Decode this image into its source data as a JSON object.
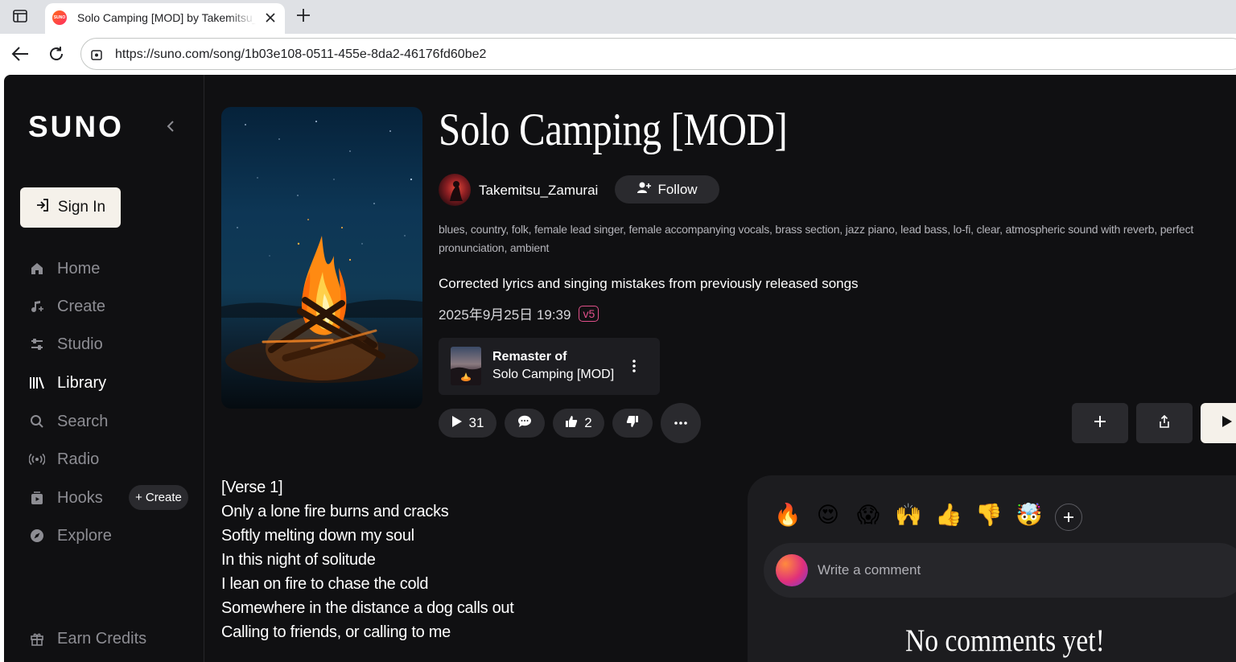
{
  "browser": {
    "tab_title": "Solo Camping [MOD] by Takemitsu_Zamurai",
    "tab_favicon_text": "SUNO",
    "url": "https://suno.com/song/1b03e108-0511-455e-8da2-46176fd60be2"
  },
  "sidebar": {
    "logo": "SUNO",
    "sign_in_label": "Sign In",
    "items": [
      {
        "label": "Home",
        "icon": "home-icon"
      },
      {
        "label": "Create",
        "icon": "music-note-icon"
      },
      {
        "label": "Studio",
        "icon": "sliders-icon"
      },
      {
        "label": "Library",
        "icon": "library-icon"
      },
      {
        "label": "Search",
        "icon": "search-icon"
      },
      {
        "label": "Radio",
        "icon": "radio-icon"
      },
      {
        "label": "Hooks",
        "icon": "hooks-icon"
      },
      {
        "label": "Explore",
        "icon": "compass-icon"
      }
    ],
    "hooks_create_label": "Create",
    "earn_credits_label": "Earn Credits",
    "active_item": "Library"
  },
  "song": {
    "title": "Solo Camping [MOD]",
    "artist": "Takemitsu_Zamurai",
    "follow_label": "Follow",
    "tags": "blues, country, folk, female lead singer, female accompanying vocals, brass section, jazz piano, lead bass, lo-fi, clear, atmospheric sound with reverb, perfect pronunciation, ambient",
    "description": "Corrected lyrics and singing mistakes from previously released songs",
    "date": "2025年9月25日 19:39",
    "version_badge": "v5",
    "remaster": {
      "label": "Remaster of",
      "song": "Solo Camping [MOD]"
    },
    "play_count": "31",
    "like_count": "2"
  },
  "lyrics": [
    "[Verse 1]",
    "Only a lone fire burns and cracks",
    "Softly melting down my soul",
    "In this night of solitude",
    "I lean on fire to chase the cold",
    "Somewhere in the distance a dog calls out",
    "Calling to friends, or calling to me"
  ],
  "comments": {
    "reactions": [
      "🔥",
      "😍",
      "😱",
      "🙌",
      "👍",
      "👎",
      "🤯"
    ],
    "placeholder": "Write a comment",
    "empty_text": "No comments yet!"
  },
  "colors": {
    "background": "#101012",
    "surface": "#2a2a2e",
    "accent_badge": "#e0508a",
    "sign_in_bg": "#f5f1ea"
  }
}
